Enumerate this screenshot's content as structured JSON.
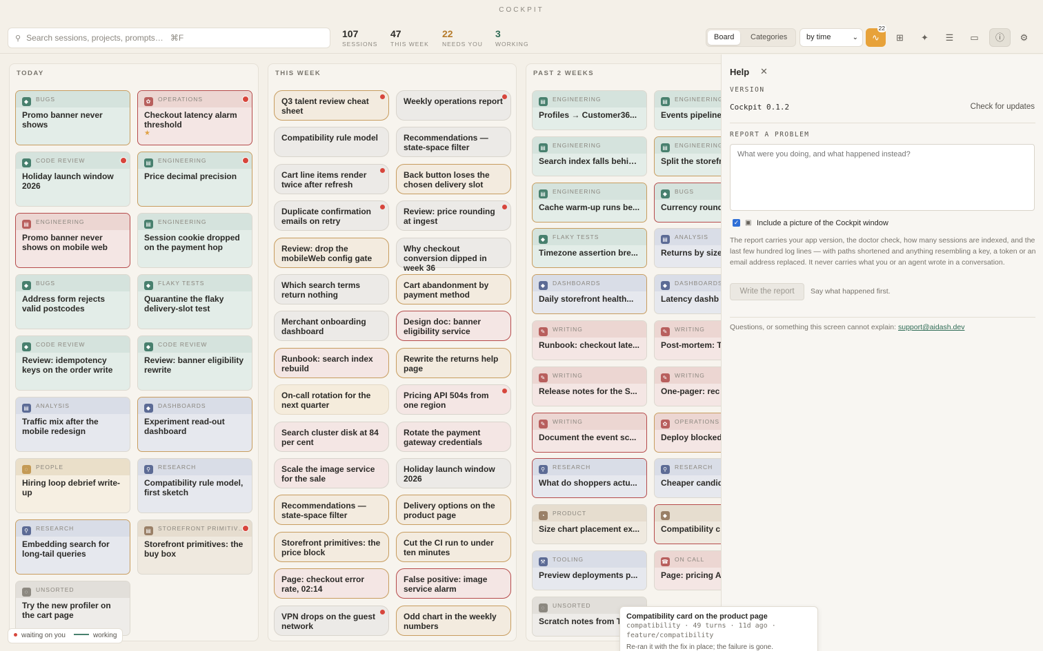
{
  "app": {
    "title": "COCKPIT"
  },
  "search": {
    "placeholder": "Search sessions, projects, prompts…",
    "shortcut": "⌘F"
  },
  "stats": [
    {
      "num": "107",
      "label": "SESSIONS",
      "color": "#2b2a27"
    },
    {
      "num": "47",
      "label": "THIS WEEK",
      "color": "#2b2a27"
    },
    {
      "num": "22",
      "label": "NEEDS YOU",
      "color": "#b57a2a"
    },
    {
      "num": "3",
      "label": "WORKING",
      "color": "#2e6b55"
    }
  ],
  "view": {
    "board": "Board",
    "categories": "Categories",
    "sort": "by time",
    "activity_count": "22"
  },
  "columns": [
    {
      "title": "TODAY"
    },
    {
      "title": "THIS WEEK"
    },
    {
      "title": "PAST 2 WEEKS"
    }
  ],
  "today": [
    {
      "cat": "BUGS",
      "title": "Promo banner never shows",
      "style": "teal",
      "border": "gold",
      "dot": false
    },
    {
      "cat": "OPERATIONS",
      "title": "Checkout latency alarm threshold",
      "style": "rose",
      "border": "red",
      "dot": true,
      "star": "★"
    },
    {
      "cat": "CODE REVIEW",
      "title": "Holiday launch window 2026",
      "style": "teal",
      "border": "",
      "dot": true
    },
    {
      "cat": "ENGINEERING",
      "title": "Price decimal precision",
      "style": "teal",
      "border": "gold",
      "dot": true
    },
    {
      "cat": "ENGINEERING",
      "title": "Promo banner never shows on mobile web",
      "style": "rose",
      "border": "red",
      "dot": false
    },
    {
      "cat": "ENGINEERING",
      "title": "Session cookie dropped on the payment hop",
      "style": "teal",
      "border": "",
      "dot": false
    },
    {
      "cat": "BUGS",
      "title": "Address form rejects valid postcodes",
      "style": "teal",
      "border": "",
      "dot": false
    },
    {
      "cat": "FLAKY TESTS",
      "title": "Quarantine the flaky delivery-slot test",
      "style": "teal",
      "border": "",
      "dot": false
    },
    {
      "cat": "CODE REVIEW",
      "title": "Review: idempotency keys on the order write",
      "style": "teal",
      "border": "",
      "dot": false
    },
    {
      "cat": "CODE REVIEW",
      "title": "Review: banner eligibility rewrite",
      "style": "teal",
      "border": "",
      "dot": false
    },
    {
      "cat": "ANALYSIS",
      "title": "Traffic mix after the mobile redesign",
      "style": "blue",
      "border": "",
      "dot": false
    },
    {
      "cat": "DASHBOARDS",
      "title": "Experiment read-out dashboard",
      "style": "blue",
      "border": "gold",
      "dot": false
    },
    {
      "cat": "PEOPLE",
      "title": "Hiring loop debrief write-up",
      "style": "cream",
      "border": "",
      "dot": false
    },
    {
      "cat": "RESEARCH",
      "title": "Compatibility rule model, first sketch",
      "style": "blue",
      "border": "",
      "dot": false
    },
    {
      "cat": "RESEARCH",
      "title": "Embedding search for long-tail queries",
      "style": "blue",
      "border": "gold",
      "dot": false
    },
    {
      "cat": "STOREFRONT PRIMITIV…",
      "title": "Storefront primitives: the buy box",
      "style": "beige",
      "border": "",
      "dot": true
    },
    {
      "cat": "UNSORTED",
      "title": "Try the new profiler on the cart page",
      "style": "gray",
      "border": "",
      "dot": false
    }
  ],
  "week": [
    {
      "title": "Q3 talent review cheat sheet",
      "style": "gold",
      "dot": true
    },
    {
      "title": "Weekly operations report",
      "style": "",
      "dot": true
    },
    {
      "title": "Compatibility rule model",
      "style": "",
      "dot": false
    },
    {
      "title": "Recommendations — state-space filter",
      "style": "",
      "dot": false
    },
    {
      "title": "Cart line items render twice after refresh",
      "style": "",
      "dot": true
    },
    {
      "title": "Back button loses the chosen delivery slot",
      "style": "gold",
      "dot": false
    },
    {
      "title": "Duplicate confirmation emails on retry",
      "style": "",
      "dot": true
    },
    {
      "title": "Review: price rounding at ingest",
      "style": "",
      "dot": true
    },
    {
      "title": "Review: drop the mobileWeb config gate",
      "style": "gold",
      "dot": false
    },
    {
      "title": "Why checkout conversion dipped in week 36",
      "style": "",
      "dot": false
    },
    {
      "title": "Which search terms return nothing",
      "style": "",
      "dot": false
    },
    {
      "title": "Cart abandonment by payment method",
      "style": "gold",
      "dot": false
    },
    {
      "title": "Merchant onboarding dashboard",
      "style": "",
      "dot": false
    },
    {
      "title": "Design doc: banner eligibility service",
      "style": "red",
      "dot": false
    },
    {
      "title": "Runbook: search index rebuild",
      "style": "gold pink",
      "dot": false
    },
    {
      "title": "Rewrite the returns help page",
      "style": "gold",
      "dot": false
    },
    {
      "title": "On-call rotation for the next quarter",
      "style": "cream",
      "dot": false
    },
    {
      "title": "Pricing API 504s from one region",
      "style": "pink",
      "dot": true
    },
    {
      "title": "Search cluster disk at 84 per cent",
      "style": "pink",
      "dot": false
    },
    {
      "title": "Rotate the payment gateway credentials",
      "style": "pink",
      "dot": false
    },
    {
      "title": "Scale the image service for the sale",
      "style": "pink",
      "dot": false
    },
    {
      "title": "Holiday launch window 2026",
      "style": "",
      "dot": false
    },
    {
      "title": "Recommendations — state-space filter",
      "style": "gold",
      "dot": false
    },
    {
      "title": "Delivery options on the product page",
      "style": "gold",
      "dot": false
    },
    {
      "title": "Storefront primitives: the price block",
      "style": "gold",
      "dot": false
    },
    {
      "title": "Cut the CI run to under ten minutes",
      "style": "gold",
      "dot": false
    },
    {
      "title": "Page: checkout error rate, 02:14",
      "style": "gold pink",
      "dot": false
    },
    {
      "title": "False positive: image service alarm",
      "style": "red",
      "dot": false
    },
    {
      "title": "VPN drops on the guest network",
      "style": "",
      "dot": true
    },
    {
      "title": "Odd chart in the weekly numbers",
      "style": "gold",
      "dot": false
    }
  ],
  "past": [
    {
      "cat": "ENGINEERING",
      "title": "Profiles → Customer36...",
      "style": "teal",
      "border": ""
    },
    {
      "cat": "ENGINEERING",
      "title": "Events pipeline",
      "style": "teal",
      "border": ""
    },
    {
      "cat": "ENGINEERING",
      "title": "Search index falls behin...",
      "style": "teal",
      "border": ""
    },
    {
      "cat": "ENGINEERING",
      "title": "Split the storefr",
      "style": "teal",
      "border": "gold"
    },
    {
      "cat": "ENGINEERING",
      "title": "Cache warm-up runs be...",
      "style": "teal",
      "border": "gold"
    },
    {
      "cat": "BUGS",
      "title": "Currency round",
      "style": "teal",
      "border": "red"
    },
    {
      "cat": "FLAKY TESTS",
      "title": "Timezone assertion bre...",
      "style": "teal",
      "border": "gold"
    },
    {
      "cat": "ANALYSIS",
      "title": "Returns by size",
      "style": "blue",
      "border": ""
    },
    {
      "cat": "DASHBOARDS",
      "title": "Daily storefront health...",
      "style": "blue",
      "border": "gold"
    },
    {
      "cat": "DASHBOARDS",
      "title": "Latency dashb",
      "style": "blue",
      "border": ""
    },
    {
      "cat": "WRITING",
      "title": "Runbook: checkout late...",
      "style": "rose",
      "border": ""
    },
    {
      "cat": "WRITING",
      "title": "Post-mortem: T",
      "style": "rose",
      "border": ""
    },
    {
      "cat": "WRITING",
      "title": "Release notes for the S...",
      "style": "rose",
      "border": ""
    },
    {
      "cat": "WRITING",
      "title": "One-pager: rec",
      "style": "rose",
      "border": ""
    },
    {
      "cat": "WRITING",
      "title": "Document the event sc...",
      "style": "rose",
      "border": "red"
    },
    {
      "cat": "OPERATIONS",
      "title": "Deploy blocked",
      "style": "rose",
      "border": "gold"
    },
    {
      "cat": "RESEARCH",
      "title": "What do shoppers actu...",
      "style": "blue",
      "border": "red"
    },
    {
      "cat": "RESEARCH",
      "title": "Cheaper candid",
      "style": "blue",
      "border": ""
    },
    {
      "cat": "PRODUCT",
      "title": "Size chart placement ex...",
      "style": "beige",
      "border": ""
    },
    {
      "cat": "",
      "title": "Compatibility c",
      "style": "beige",
      "border": "red"
    },
    {
      "cat": "TOOLING",
      "title": "Preview deployments p...",
      "style": "blue",
      "border": ""
    },
    {
      "cat": "ON CALL",
      "title": "Page: pricing A",
      "style": "rose",
      "border": ""
    },
    {
      "cat": "UNSORTED",
      "title": "Scratch notes from T",
      "style": "gray",
      "border": ""
    }
  ],
  "legend": {
    "waiting": "waiting on you",
    "working": "working"
  },
  "help": {
    "title": "Help",
    "version_label": "VERSION",
    "version": "Cockpit 0.1.2",
    "check": "Check for updates",
    "report_label": "REPORT A PROBLEM",
    "placeholder": "What were you doing, and what happened instead?",
    "include": "Include a picture of the Cockpit window",
    "desc": "The report carries your app version, the doctor check, how many sessions are indexed, and the last few hundred log lines — with paths shortened and anything resembling a key, a token or an email address replaced. It never carries what you or an agent wrote in a conversation.",
    "write": "Write the report",
    "write_note": "Say what happened first.",
    "questions": "Questions, or something this screen cannot explain:",
    "email": "support@aidash.dev"
  },
  "tooltip": {
    "title": "Compatibility card on the product page",
    "meta": "compatibility · 49 turns · 11d ago ·",
    "branch": "feature/compatibility",
    "desc": "Re-ran it with the fix in place; the failure is gone."
  }
}
